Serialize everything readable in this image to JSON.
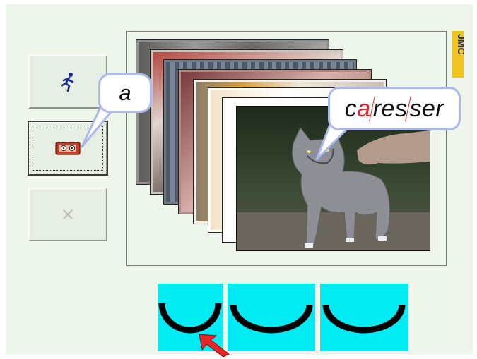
{
  "bubble": {
    "letter": "a",
    "word_parts": [
      "ca",
      "a",
      "res",
      "ser"
    ],
    "word_full": "caresser"
  },
  "colors": {
    "background": "#eef5ea",
    "bubble_border": "#a9b9ee",
    "accent_red": "#d8262a",
    "syllable_box": "#00ecf4"
  },
  "buttons": [
    {
      "name": "run-button",
      "icon": "running-man-icon"
    },
    {
      "name": "listen-button",
      "icon": "cassette-tape-icon",
      "selected": true
    },
    {
      "name": "close-button",
      "icon": "close-icon",
      "disabled": true
    }
  ],
  "logo": {
    "text": "JMC"
  },
  "syllables": {
    "count": 3,
    "current": 1
  }
}
